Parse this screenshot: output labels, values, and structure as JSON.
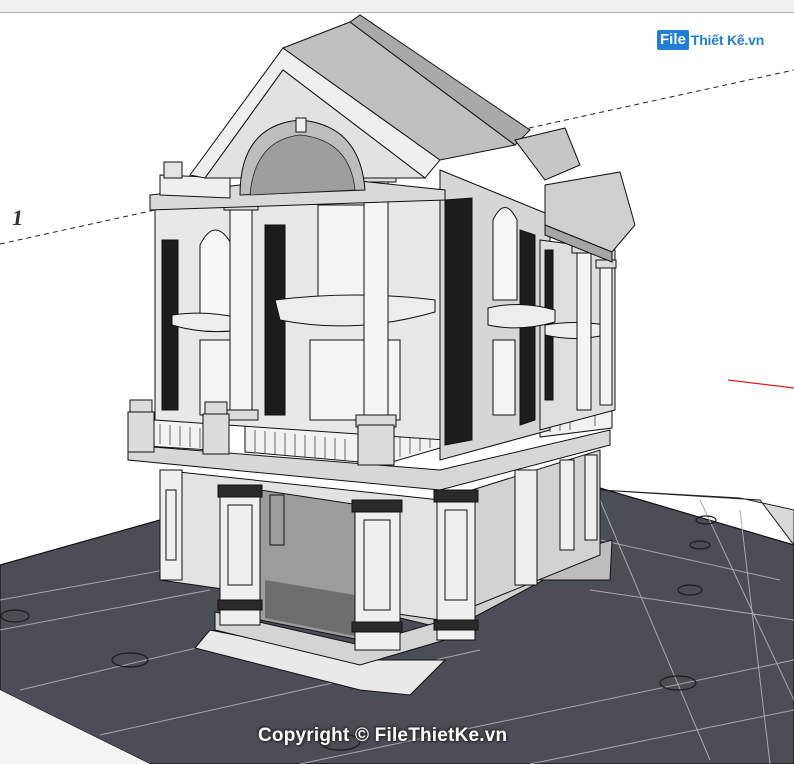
{
  "watermark": {
    "logo_prefix": "File",
    "logo_suffix": "Thiết Kế.vn",
    "copyright": "Copyright © FileThietKe.vn"
  },
  "viewport": {
    "section_label": "1"
  },
  "colors": {
    "ground": "#4b4f55",
    "wall": "#e6e6e6",
    "roof": "#c9c9c9",
    "window": "#1c1c1c",
    "accent_axis_red": "#d62020",
    "accent_axis_green": "#1f8f1f",
    "logo_blue": "#1f7fd6"
  },
  "icons": {
    "model": "villa-3d-model"
  }
}
